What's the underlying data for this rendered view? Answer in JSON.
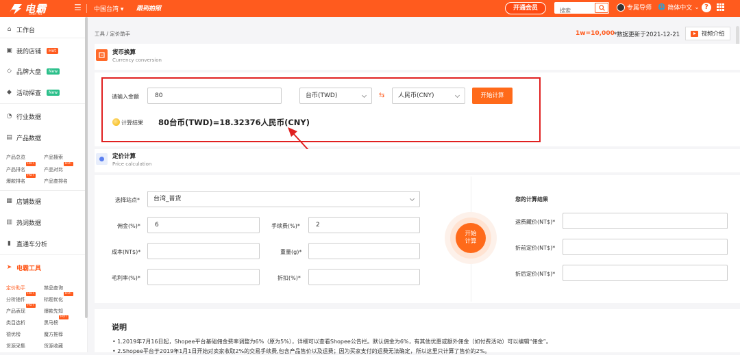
{
  "topbar": {
    "brand": "电霸",
    "brand_sub": "Dian Ba",
    "region": "中国台湾",
    "promo": "跟到拍照",
    "vip_button": "开通会员",
    "search_placeholder": "搜索",
    "mentor": "专属导师",
    "language": "简体中文",
    "help": "?"
  },
  "sidebar": {
    "workbench": "工作台",
    "my_store": "我的店铺",
    "my_store_badge": "Hot",
    "brand_market": "品牌大盘",
    "brand_market_badge": "New",
    "activity": "活动探查",
    "activity_badge": "New",
    "industry": "行业数据",
    "product_data": "产品数据",
    "product_sub": [
      "产品总览",
      "产品搜索",
      "产品排名",
      "产品对比",
      "爆款排名",
      "产品查排名"
    ],
    "store_data": "店铺数据",
    "keyword_data": "热词数据",
    "ads": "直通车分析",
    "tools_title": "电霸工具",
    "tools_sub": [
      "定价助手",
      "禁品查询",
      "分析插件",
      "标题优化",
      "产品表现",
      "爆款先知",
      "类目选析",
      "黑马榜",
      "德优榜",
      "魔方推荐",
      "货源采集",
      "货源收藏"
    ],
    "hot_label": "HOT"
  },
  "header": {
    "breadcrumb": "工具 / 定价助手",
    "rate": "1w=10,000",
    "updated": "*数据更新于2021-12-21",
    "video_button": "视频介绍"
  },
  "currency": {
    "title": "货币换算",
    "subtitle": "Currency conversion",
    "amount_label": "请输入金额",
    "amount_value": "80",
    "from_currency": "台币(TWD)",
    "to_currency": "人民币(CNY)",
    "calc_button": "开始计算",
    "result_label": "计算结果",
    "result_value": "80台币(TWD)=18.32376人民币(CNY)"
  },
  "pricing": {
    "title": "定价计算",
    "subtitle": "Price calculation",
    "site_label": "选择站点*",
    "site_value": "台湾_普货",
    "commission_label": "佣金(%)*",
    "commission_value": "6",
    "fee_label": "手续费(%)*",
    "fee_value": "2",
    "cost_label": "成本(NT$)*",
    "weight_label": "重量(g)*",
    "margin_label": "毛利率(%)*",
    "discount_label": "折扣(%)*",
    "calc_button_line1": "开始",
    "calc_button_line2": "计算",
    "result_title": "您的计算结果",
    "shipping_label": "运费藏价(NT$)*",
    "before_label": "折前定价(NT$)*",
    "after_label": "折后定价(NT$)*"
  },
  "notes": {
    "title": "说明",
    "line1": "1.2019年7月16日起，Shopee平台基础佣金费率调整为6%（原为5%），详细可以查看Shopee公告栏。默认佣金为6%，有其他优惠或额外佣金（如付费活动）可以编辑“佣金”。",
    "line2": "2.Shopee平台于2019年1月1日开始对卖家收取2%的交易手续费,包含产品售价以及运费；因为买家支付的运费无法确定，所以这里只计算了售价的2%。"
  },
  "colors": {
    "brand": "#ff5b1e",
    "highlight_box": "#e02020"
  }
}
